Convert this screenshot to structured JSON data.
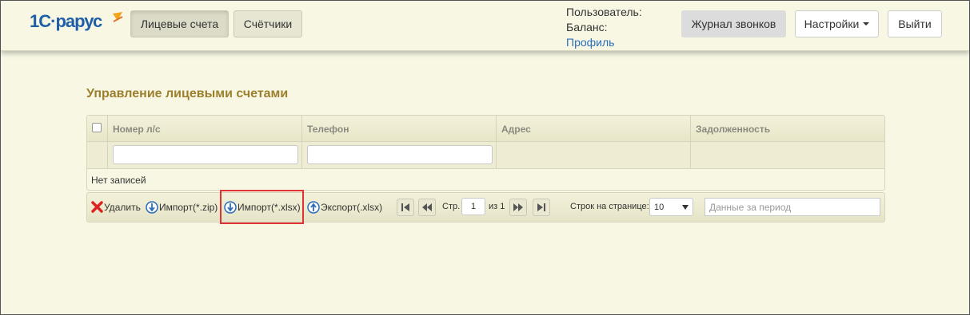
{
  "navbar": {
    "tabs": [
      {
        "label": "Лицевые счета",
        "active": true
      },
      {
        "label": "Счётчики",
        "active": false
      }
    ],
    "user_label": "Пользователь:",
    "balance_label": "Баланс:",
    "profile_link": "Профиль",
    "call_log_button": "Журнал звонков",
    "settings_button": "Настройки",
    "logout_button": "Выйти",
    "logo_icon": "1c-rarus-logo",
    "brand_color": "#2a6ebb"
  },
  "main": {
    "title": "Управление лицевыми счетами",
    "title_color": "#9c7f2d",
    "columns": [
      "Номер л/с",
      "Телефон",
      "Адрес",
      "Задолженность"
    ],
    "empty_text": "Нет записей"
  },
  "toolbar": {
    "delete_label": "Удалить",
    "import_zip_label": "Импорт(*.zip)",
    "import_xlsx_label": "Импорт(*.xlsx)",
    "export_label": "Экспорт(.xlsx)",
    "page_label": "Стр.",
    "current_page": "1",
    "of_pages": "из 1",
    "rows_per_page_label": "Строк на странице:",
    "rows_per_page_value": "10",
    "period_placeholder": "Данные за период",
    "icons": [
      "delete-icon",
      "download-icon",
      "upload-icon",
      "first-page-icon",
      "prev-page-icon",
      "next-page-icon",
      "last-page-icon"
    ]
  }
}
